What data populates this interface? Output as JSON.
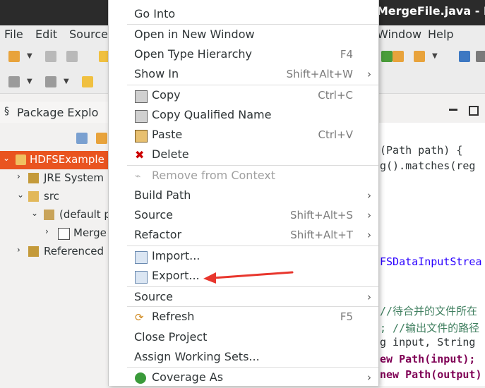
{
  "window": {
    "title": "/MergeFile.java - E"
  },
  "menubar": {
    "file": "File",
    "edit": "Edit",
    "source": "Source",
    "window": "Window",
    "help": "Help"
  },
  "package_explorer": {
    "title": "Package Explo",
    "tree": [
      {
        "label": "HDFSExample",
        "arrow": "⌄",
        "selected": true
      },
      {
        "label": "JRE System L",
        "arrow": "›"
      },
      {
        "label": "src",
        "arrow": "⌄"
      },
      {
        "label": "(default p",
        "arrow": "⌄"
      },
      {
        "label": "Merge",
        "arrow": "›"
      },
      {
        "label": "Referenced",
        "arrow": "›"
      }
    ]
  },
  "editor": {
    "lines": [
      "(Path path) {",
      "g().matches(reg",
      "FSDataInputStrea",
      " //待合并的文件所在",
      "; //输出文件的路径",
      "g input, String",
      "ew Path(input);",
      "new Path(output)"
    ]
  },
  "context_menu": {
    "items": [
      {
        "label": "Go Into"
      },
      {
        "label": "Open in New Window"
      },
      {
        "label": "Open Type Hierarchy",
        "shortcut": "F4"
      },
      {
        "label": "Show In",
        "shortcut": "Shift+Alt+W",
        "submenu": "›"
      },
      {
        "label": "Copy",
        "shortcut": "Ctrl+C",
        "icon": "copy-icon"
      },
      {
        "label": "Copy Qualified Name",
        "icon": "copy-qualified-icon"
      },
      {
        "label": "Paste",
        "shortcut": "Ctrl+V",
        "icon": "paste-icon"
      },
      {
        "label": "Delete",
        "icon": "delete-icon"
      },
      {
        "label": "Remove from Context",
        "disabled": true,
        "icon": "remove-context-icon"
      },
      {
        "label": "Build Path",
        "submenu": "›"
      },
      {
        "label": "Source",
        "shortcut": "Shift+Alt+S",
        "submenu": "›"
      },
      {
        "label": "Refactor",
        "shortcut": "Shift+Alt+T",
        "submenu": "›"
      },
      {
        "label": "Import...",
        "icon": "import-icon"
      },
      {
        "label": "Export...",
        "icon": "export-icon"
      },
      {
        "label": "Source",
        "submenu": "›"
      },
      {
        "label": "Refresh",
        "shortcut": "F5",
        "icon": "refresh-icon"
      },
      {
        "label": "Close Project"
      },
      {
        "label": "Assign Working Sets..."
      },
      {
        "label": "Coverage As",
        "submenu": "›",
        "icon": "coverage-icon"
      }
    ]
  },
  "colors": {
    "selection": "#e95420",
    "delete_red": "#cc0000",
    "annotation_arrow": "#e8362d"
  }
}
